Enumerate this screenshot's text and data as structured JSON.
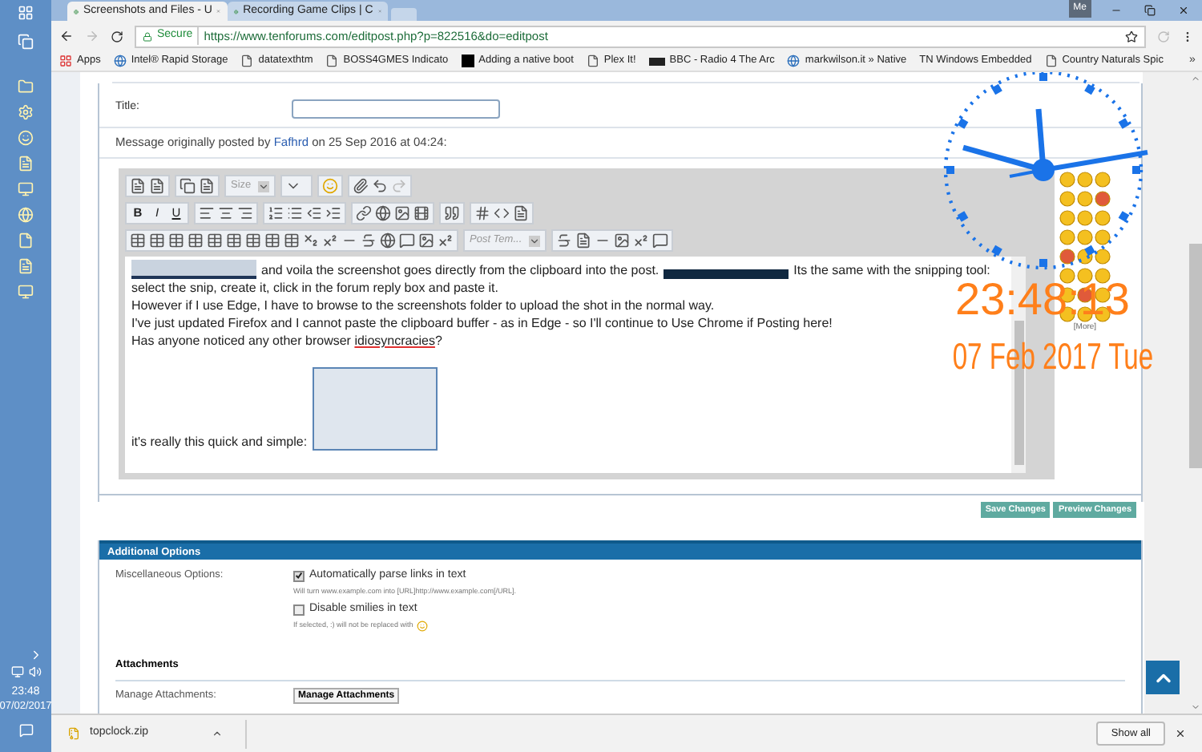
{
  "taskbar": {
    "time": "23:48",
    "date": "07/02/2017"
  },
  "tabs": [
    {
      "title": "Screenshots and Files - U",
      "selected": true
    },
    {
      "title": "Recording Game Clips | C",
      "selected": false
    }
  ],
  "profile": "Me",
  "address": {
    "secure_label": "Secure",
    "url": "https://www.tenforums.com/editpost.php?p=822516&do=editpost"
  },
  "bookmarks": [
    {
      "label": "Apps",
      "kind": "apps"
    },
    {
      "label": "Intel® Rapid Storage",
      "kind": "globe"
    },
    {
      "label": "datatexthtm",
      "kind": "page"
    },
    {
      "label": "BOSS4GMES Indicato",
      "kind": "page"
    },
    {
      "label": "Adding a native boot",
      "kind": "m"
    },
    {
      "label": "Plex It!",
      "kind": "page"
    },
    {
      "label": "BBC - Radio 4 The Arc",
      "kind": "bbc"
    },
    {
      "label": "markwilson.it » Native",
      "kind": "globe"
    },
    {
      "label": "TN Windows Embedded",
      "kind": "none"
    },
    {
      "label": "Country Naturals Spic",
      "kind": "page"
    }
  ],
  "bookmarks_more": "»",
  "form": {
    "title_label": "Title:",
    "message_note": {
      "before": "Message originally posted by ",
      "author": "Fafhrd",
      "after": " on 25 Sep 2016 at 04:24:"
    }
  },
  "editor": {
    "size_label": "Size",
    "template_label": "Post Tem...",
    "format_keys": [
      "B",
      "I",
      "U"
    ],
    "body": [
      {
        "kind": "line1",
        "before": "and voila the screenshot goes directly from the clipboard into the post.",
        "after": "Its the same with the snipping tool:"
      },
      {
        "kind": "text",
        "text": "select the snip, create it, click in the forum reply box and paste it."
      },
      {
        "kind": "text",
        "text": "However if I use Edge, I have to browse to the screenshots folder to upload the shot in the normal way."
      },
      {
        "kind": "text",
        "text": "I've just updated Firefox and I cannot paste the clipboard buffer - as in Edge - so I'll continue to Use Chrome if Posting here!"
      },
      {
        "kind": "spell",
        "before": "Has anyone noticed any other browser ",
        "misspelled": "idiosyncracies",
        "after": "?"
      },
      {
        "kind": "image_line",
        "text": "it's really this quick and simple:"
      }
    ],
    "smilies_more": "[More]"
  },
  "clock": {
    "time": "23:48:13",
    "date": "07 Feb 2017 Tue"
  },
  "buttons": [
    "Save Changes",
    "Preview Changes"
  ],
  "options": {
    "header": "Additional Options",
    "misc_label": "Miscellaneous Options:",
    "items": [
      {
        "label": "Automatically parse links in text",
        "checked": true,
        "hint": "Will turn www.example.com into [URL]http://www.example.com[/URL].",
        "hint_icon": false
      },
      {
        "label": "Disable smilies in text",
        "checked": false,
        "hint": "If selected, :) will not be replaced with",
        "hint_icon": true
      }
    ]
  },
  "attachments": {
    "heading": "Attachments",
    "label": "Manage Attachments:",
    "button": "Manage Attachments"
  },
  "download": {
    "file": "topclock.zip",
    "show_all": "Show all"
  }
}
